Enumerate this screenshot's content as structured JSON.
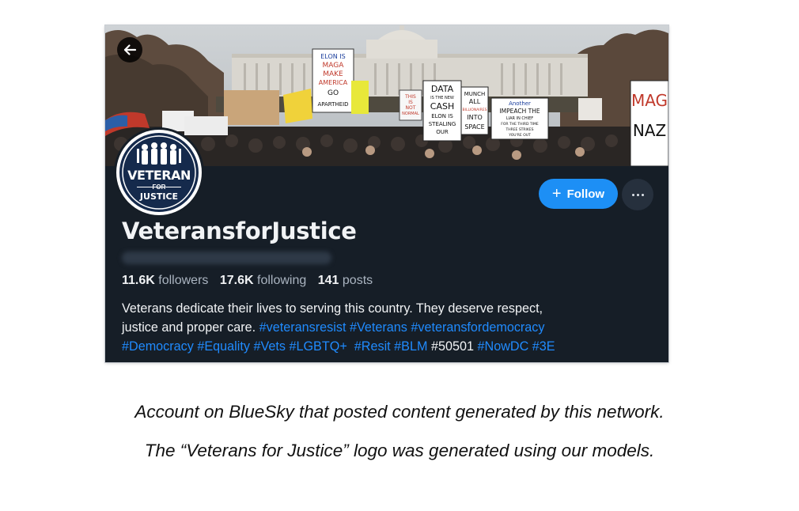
{
  "profile": {
    "back_icon": "arrow-left-icon",
    "logo": {
      "line1": "VETERAN",
      "line2": "FOR",
      "line3": "JUSTICE"
    },
    "follow_label": "Follow",
    "more_icon": "ellipsis-icon",
    "display_name": "VeteransforJustice",
    "stats": {
      "followers_count": "11.6K",
      "followers_label": "followers",
      "following_count": "17.6K",
      "following_label": "following",
      "posts_count": "141",
      "posts_label": "posts"
    },
    "bio": {
      "line1": "Veterans dedicate their lives to serving this country. They deserve respect,",
      "line2_text": "justice and proper care.",
      "line2_tags": [
        "#veteransresist",
        "#Veterans",
        "#veteransfordemocracy"
      ],
      "line3_tags": [
        "#Democracy",
        "#Equality",
        "#Vets",
        "#LGBTQ+",
        "#Resit",
        "#BLM"
      ],
      "line3_plain": "#50501",
      "line3_tags_end": [
        "#NowDC",
        "#3E"
      ]
    },
    "banner_signs": {
      "sign1": [
        "ELON IS",
        "MAGA",
        "MAKE",
        "AMERICA",
        "GO",
        "APARTHEID"
      ],
      "sign2": [
        "DATA",
        "IS THE NEW",
        "CASH",
        "ELON IS",
        "STEALING",
        "OUR"
      ],
      "sign3": [
        "MUNCH",
        "ALL",
        "BILLIONAIRES",
        "INTO",
        "SPACE"
      ],
      "sign4": [
        "Another",
        "IMPEACH THE",
        "LIAR IN CHIEF",
        "FOR THE THIRD TIME",
        "THREE STRIKES",
        "YOU'RE OUT"
      ],
      "sign5": [
        "MAG",
        "NAZ"
      ],
      "sign6": [
        "THIS",
        "IS",
        "NOT",
        "NORMAL"
      ]
    }
  },
  "captions": {
    "line1": "Account on BlueSky that posted content generated by this network.",
    "line2": "The “Veterans for Justice” logo was generated using our models."
  },
  "colors": {
    "card_bg": "#161e27",
    "accent": "#1d8ff5",
    "hashtag": "#208bfe",
    "logo_bg": "#152a4c"
  }
}
